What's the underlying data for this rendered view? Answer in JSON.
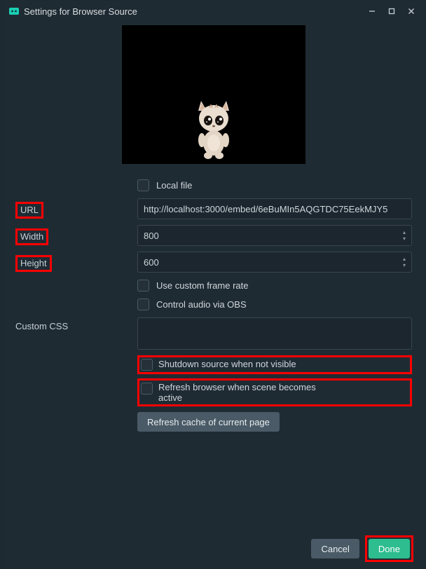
{
  "title": "Settings for Browser Source",
  "fields": {
    "local_file_label": "Local file",
    "url_label": "URL",
    "url_value": "http://localhost:3000/embed/6eBuMIn5AQGTDC75EekMJY5",
    "width_label": "Width",
    "width_value": "800",
    "height_label": "Height",
    "height_value": "600",
    "custom_frame_label": "Use custom frame rate",
    "control_audio_label": "Control audio via OBS",
    "custom_css_label": "Custom CSS",
    "custom_css_value": "",
    "shutdown_label": "Shutdown source when not visible",
    "refresh_scene_label": "Refresh browser when scene becomes active",
    "refresh_cache_label": "Refresh cache of current page"
  },
  "buttons": {
    "cancel": "Cancel",
    "done": "Done"
  }
}
